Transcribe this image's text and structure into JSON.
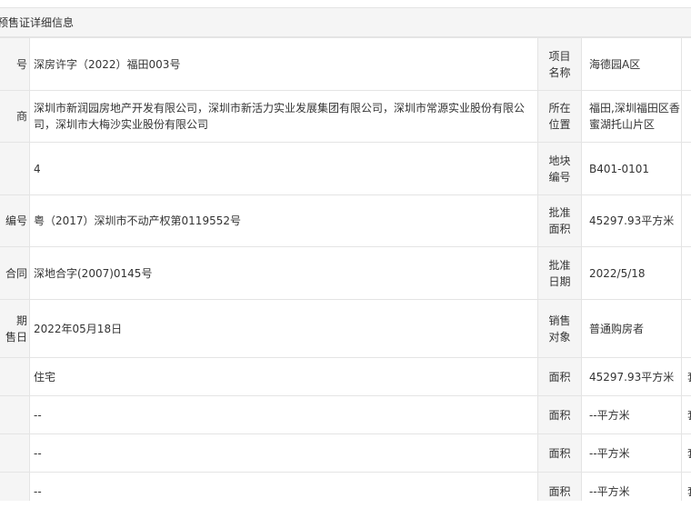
{
  "panel": {
    "title": "预售证详细信息"
  },
  "rows": [
    {
      "label": "号",
      "value": "深房许字（2022）福田003号",
      "label2": "项目名称",
      "value2": "海德园A区",
      "extra": ""
    },
    {
      "label": "商",
      "value": "深圳市新润园房地产开发有限公司，深圳市新活力实业发展集团有限公司，深圳市常源实业股份有限公司，深圳市大梅沙实业股份有限公司",
      "label2": "所在位置",
      "value2": "福田,深圳福田区香蜜湖托山片区",
      "extra": ""
    },
    {
      "label": "",
      "value": "4",
      "label2": "地块编号",
      "value2": "B401-0101",
      "extra": ""
    },
    {
      "label": "编号",
      "value": "粤（2017）深圳市不动产权第0119552号",
      "label2": "批准面积",
      "value2": "45297.93平方米",
      "extra": ""
    },
    {
      "label": "合同",
      "value": "深地合字(2007)0145号",
      "label2": "批准日期",
      "value2": "2022/5/18",
      "extra": ""
    },
    {
      "label": "期\n售日",
      "value": "2022年05月18日",
      "label2": "销售对象",
      "value2": "普通购房者",
      "extra": ""
    },
    {
      "label": "",
      "value": "住宅",
      "label2": "面积",
      "value2": "45297.93平方米",
      "extra": "套"
    },
    {
      "label": "",
      "value": "--",
      "label2": "面积",
      "value2": "--平方米",
      "extra": "套"
    },
    {
      "label": "",
      "value": "--",
      "label2": "面积",
      "value2": "--平方米",
      "extra": "套"
    },
    {
      "label": "",
      "value": "--",
      "label2": "面积",
      "value2": "--平方米",
      "extra": "套"
    }
  ]
}
